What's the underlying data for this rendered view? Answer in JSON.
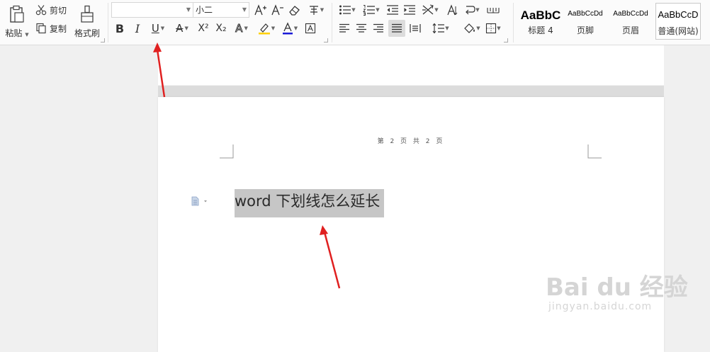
{
  "clipboard": {
    "paste_label": "粘贴",
    "cut_label": "剪切",
    "copy_label": "复制",
    "format_painter_label": "格式刷"
  },
  "font": {
    "family_value": "",
    "size_value": "小二"
  },
  "styles": [
    {
      "sample": "AaBbC",
      "name": "标题 4"
    },
    {
      "sample": "AaBbCcDd",
      "name": "页脚"
    },
    {
      "sample": "AaBbCcDd",
      "name": "页眉"
    },
    {
      "sample": "AaBbCcD",
      "name": "普通(网站)"
    }
  ],
  "document": {
    "page_info": "第 2 页 共 2 页",
    "heading_text": "word 下划线怎么延长"
  },
  "watermark": {
    "logo_text": "Bai du 经验",
    "url": "jingyan.baidu.com"
  },
  "colors": {
    "font_color": "#1a1ad8",
    "highlight_color": "#ffd000",
    "annotation_arrow": "#e02020",
    "selection_bg": "#c6c6c6"
  }
}
